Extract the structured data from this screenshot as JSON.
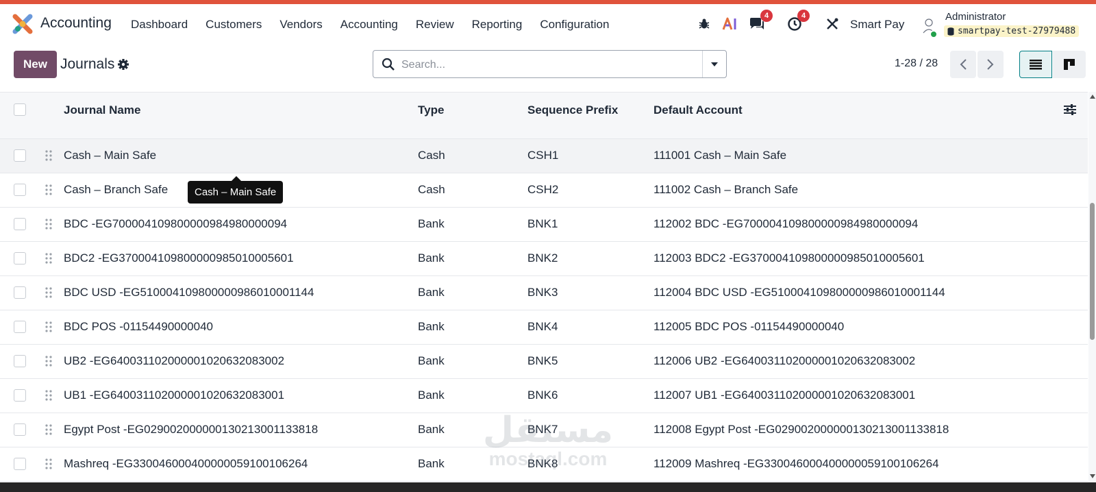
{
  "app": {
    "name": "Accounting"
  },
  "menu": [
    "Dashboard",
    "Customers",
    "Vendors",
    "Accounting",
    "Review",
    "Reporting",
    "Configuration"
  ],
  "systray": {
    "debug_icon": "bug-icon",
    "ai_icon": "ai-icon",
    "messages_badge": "4",
    "activities_badge": "4",
    "company": "Smart Pay",
    "user": "Administrator",
    "database": "smartpay-test-27979488"
  },
  "control_panel": {
    "new_label": "New",
    "title": "Journals",
    "search_placeholder": "Search...",
    "pager": "1-28 / 28"
  },
  "table": {
    "columns": [
      "Journal Name",
      "Type",
      "Sequence Prefix",
      "Default Account"
    ],
    "rows": [
      {
        "name": "Cash – Main Safe",
        "type": "Cash",
        "prefix": "CSH1",
        "account": "111001 Cash – Main Safe"
      },
      {
        "name": "Cash – Branch Safe",
        "type": "Cash",
        "prefix": "CSH2",
        "account": "111002 Cash – Branch Safe"
      },
      {
        "name": "BDC -EG700004109800000984980000094",
        "type": "Bank",
        "prefix": "BNK1",
        "account": "112002 BDC -EG700004109800000984980000094"
      },
      {
        "name": "BDC2 -EG370004109800000985010005601",
        "type": "Bank",
        "prefix": "BNK2",
        "account": "112003 BDC2 -EG370004109800000985010005601"
      },
      {
        "name": "BDC USD -EG510004109800000986010001144",
        "type": "Bank",
        "prefix": "BNK3",
        "account": "112004 BDC USD -EG510004109800000986010001144"
      },
      {
        "name": "BDC POS -01154490000040",
        "type": "Bank",
        "prefix": "BNK4",
        "account": "112005 BDC POS -01154490000040"
      },
      {
        "name": "UB2 -EG640031102000001020632083002",
        "type": "Bank",
        "prefix": "BNK5",
        "account": "112006 UB2 -EG640031102000001020632083002"
      },
      {
        "name": "UB1 -EG640031102000001020632083001",
        "type": "Bank",
        "prefix": "BNK6",
        "account": "112007 UB1 -EG640031102000001020632083001"
      },
      {
        "name": "Egypt Post -EG029002000000130213001133818",
        "type": "Bank",
        "prefix": "BNK7",
        "account": "112008 Egypt Post -EG029002000000130213001133818"
      },
      {
        "name": "Mashreq -EG330046000400000059100106264",
        "type": "Bank",
        "prefix": "BNK8",
        "account": "112009 Mashreq -EG330046000400000059100106264"
      }
    ]
  },
  "tooltip": "Cash – Main Safe",
  "watermark": {
    "arabic": "مستقل",
    "latin": "mostaql.com"
  },
  "colors": {
    "brand": "#714b67",
    "accent": "#017e84",
    "badge": "#d9363e",
    "top_strip": "#e0533b"
  }
}
